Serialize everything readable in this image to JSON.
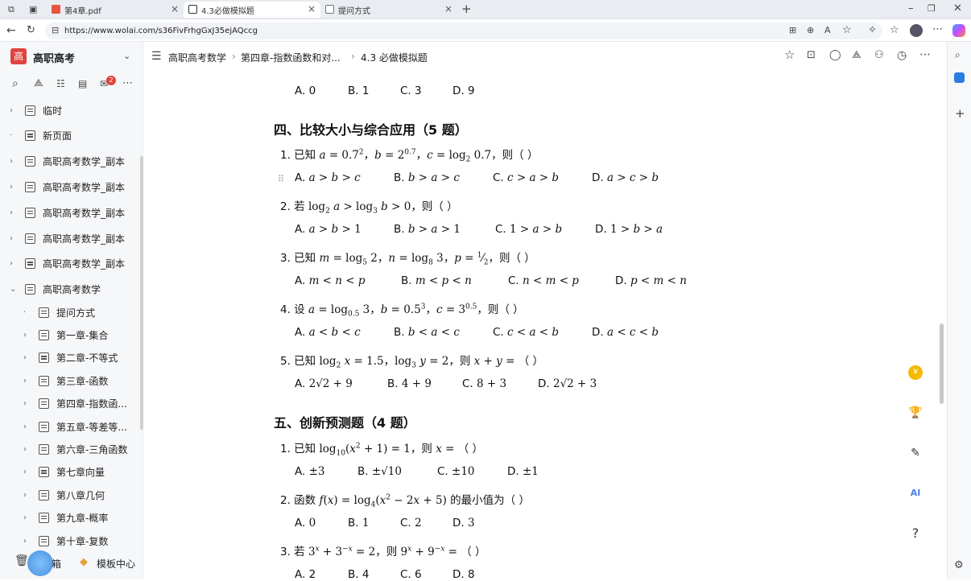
{
  "browser": {
    "tabs": [
      {
        "label": "第4章.pdf"
      },
      {
        "label": "4.3必做模拟题"
      },
      {
        "label": "提问方式"
      }
    ],
    "url": "https://www.wolai.com/s36FivFrhgGxJ35ejAQccg"
  },
  "sidebar": {
    "workspace_icon": "高",
    "workspace_name": "高职高考",
    "notification_count": "2",
    "items": [
      {
        "label": "临时"
      },
      {
        "label": "新页面"
      },
      {
        "label": "高职高考数学_副本"
      },
      {
        "label": "高职高考数学_副本"
      },
      {
        "label": "高职高考数学_副本"
      },
      {
        "label": "高职高考数学_副本"
      },
      {
        "label": "高职高考数学_副本"
      },
      {
        "label": "高职高考数学"
      },
      {
        "label": "提问方式"
      },
      {
        "label": "第一章-集合"
      },
      {
        "label": "第二章-不等式"
      },
      {
        "label": "第三章-函数"
      },
      {
        "label": "第四章-指数函..."
      },
      {
        "label": "第五章-等差等..."
      },
      {
        "label": "第六章-三角函数"
      },
      {
        "label": "第七章向量"
      },
      {
        "label": "第八章几何"
      },
      {
        "label": "第九章-概率"
      },
      {
        "label": "第十章-复数"
      }
    ],
    "footer": {
      "trash_label": "箱",
      "template_label": "模板中心"
    }
  },
  "breadcrumb": {
    "items": [
      {
        "label": "高职高考数学"
      },
      {
        "label": "第四章-指数函数和对..."
      },
      {
        "label": "4.3 必做模拟题"
      }
    ]
  },
  "content": {
    "prev_options": [
      "A. 0",
      "B. 1",
      "C. 3",
      "D. 9"
    ],
    "section4": {
      "title": "四、比较大小与综合应用（5 题）"
    },
    "section5": {
      "title": "五、创新预测题（4 题）"
    },
    "q_prefix": {
      "q4_1": "1. 已知",
      "q4_2": "2. 若",
      "q4_3": "3. 已知",
      "q4_4": "4. 设",
      "q4_5": "5. 已知",
      "q5_1": "1. 已知",
      "q5_2": "2. 函数",
      "q5_3": "3. 若"
    },
    "q_suffix": {
      "then": "，则（ ）",
      "q5_2": "的最小值为（ ）"
    },
    "last_options": [
      "A. 2",
      "B. 4",
      "C. 6",
      "D. 8"
    ]
  },
  "colors": {
    "accent": "#e0433e",
    "coin": "#f5b800"
  }
}
